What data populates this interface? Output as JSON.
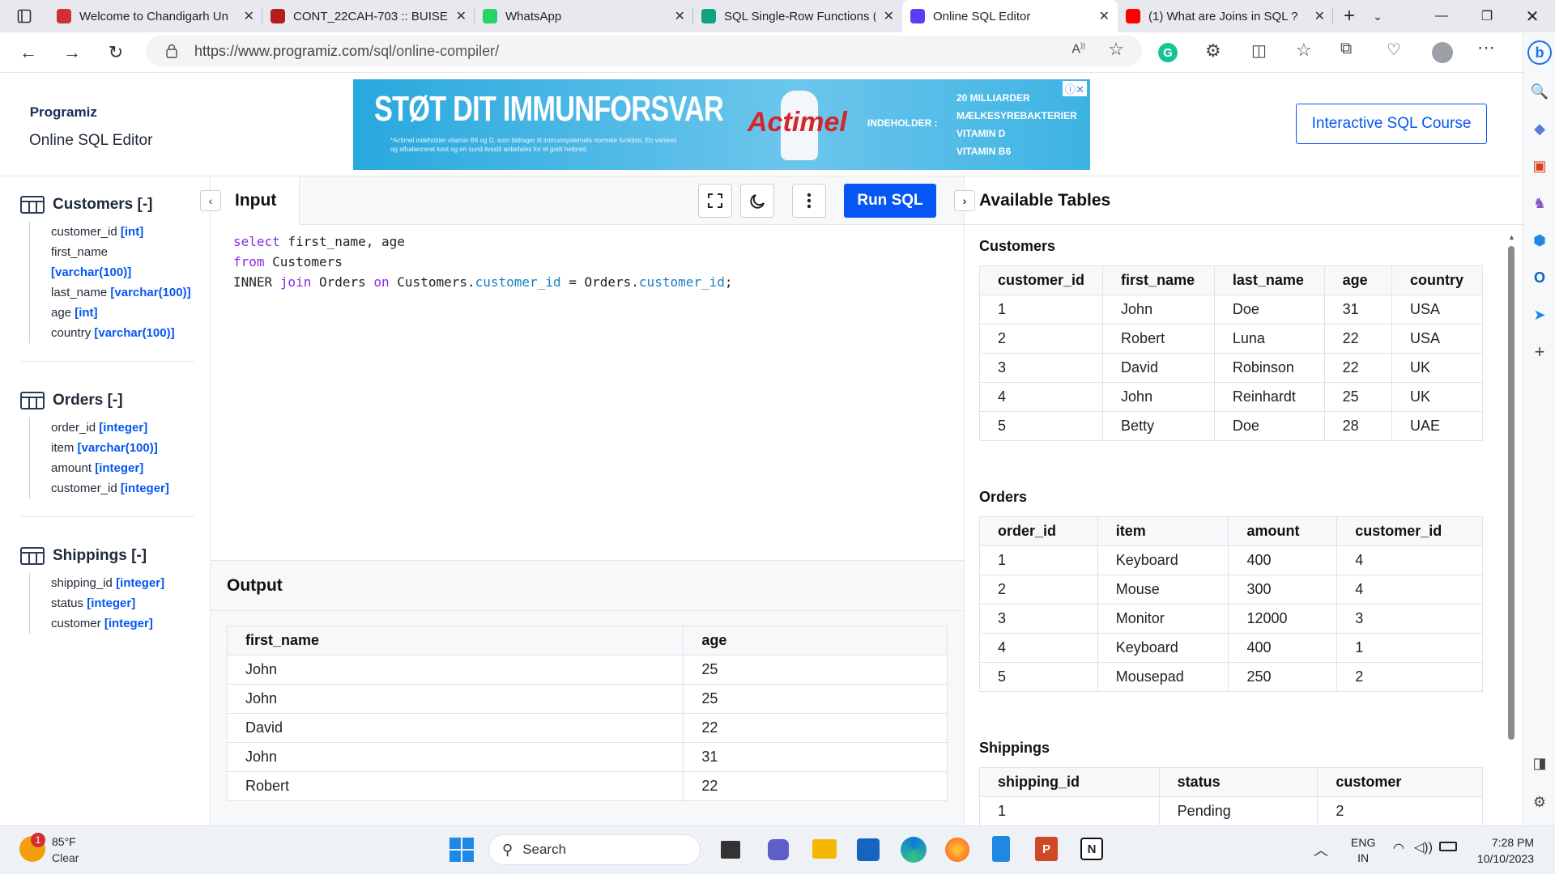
{
  "browser": {
    "tabs": [
      {
        "label": "Welcome to Chandigarh Un",
        "color": "#d32f2f"
      },
      {
        "label": "CONT_22CAH-703 :: BUISE",
        "color": "#b71c1c"
      },
      {
        "label": "WhatsApp",
        "color": "#25d366"
      },
      {
        "label": "SQL Single-Row Functions (",
        "color": "#10a37f"
      },
      {
        "label": "Online SQL Editor",
        "color": "#5b3df5"
      },
      {
        "label": "(1) What are Joins in SQL ?",
        "color": "#ff0000"
      }
    ],
    "url_host": "https://www.programiz.com",
    "url_path": "/sql/online-compiler/"
  },
  "header": {
    "logo": "Programiz",
    "subtitle": "Online SQL Editor",
    "course_button": "Interactive SQL Course"
  },
  "ad": {
    "headline": "STØT DIT IMMUNFORSVAR",
    "smallprint": "*Actimel indeholder vitamin B6 og D, som bidrager til immunsystemets normale funktion. En varieret og afbalanceret kost og en sund livsstil anbefales for et godt helbred.",
    "brand": "Actimel",
    "contains": "INDEHOLDER :",
    "facts": [
      "20 MILLIARDER MÆLKESYREBAKTERIER",
      "VITAMIN D",
      "VITAMIN B6"
    ]
  },
  "schema": [
    {
      "name": "Customers [-]",
      "columns": [
        {
          "name": "customer_id",
          "type": "[int]"
        },
        {
          "name": "first_name",
          "type": "[varchar(100)]"
        },
        {
          "name": "last_name",
          "type": "[varchar(100)]"
        },
        {
          "name": "age",
          "type": "[int]"
        },
        {
          "name": "country",
          "type": "[varchar(100)]"
        }
      ]
    },
    {
      "name": "Orders [-]",
      "columns": [
        {
          "name": "order_id",
          "type": "[integer]"
        },
        {
          "name": "item",
          "type": "[varchar(100)]"
        },
        {
          "name": "amount",
          "type": "[integer]"
        },
        {
          "name": "customer_id",
          "type": "[integer]"
        }
      ]
    },
    {
      "name": "Shippings [-]",
      "columns": [
        {
          "name": "shipping_id",
          "type": "[integer]"
        },
        {
          "name": "status",
          "type": "[integer]"
        },
        {
          "name": "customer",
          "type": "[integer]"
        }
      ]
    }
  ],
  "editor": {
    "tab": "Input",
    "run": "Run SQL",
    "code": [
      [
        [
          "kw",
          "select"
        ],
        [
          "t",
          " first_name, age"
        ]
      ],
      [
        [
          "kw",
          "from"
        ],
        [
          "t",
          " Customers"
        ]
      ],
      [
        [
          "t",
          "INNER "
        ],
        [
          "kw",
          "join"
        ],
        [
          "t",
          " Orders "
        ],
        [
          "kw",
          "on"
        ],
        [
          "t",
          " Customers."
        ],
        [
          "fld",
          "customer_id"
        ],
        [
          "t",
          " = Orders."
        ],
        [
          "fld",
          "customer_id"
        ],
        [
          "t",
          ";"
        ]
      ]
    ]
  },
  "output": {
    "title": "Output",
    "headers": [
      "first_name",
      "age"
    ],
    "rows": [
      [
        "John",
        "25"
      ],
      [
        "John",
        "25"
      ],
      [
        "David",
        "22"
      ],
      [
        "John",
        "31"
      ],
      [
        "Robert",
        "22"
      ]
    ]
  },
  "available": {
    "title": "Available Tables",
    "tables": [
      {
        "name": "Customers",
        "headers": [
          "customer_id",
          "first_name",
          "last_name",
          "age",
          "country"
        ],
        "rows": [
          [
            "1",
            "John",
            "Doe",
            "31",
            "USA"
          ],
          [
            "2",
            "Robert",
            "Luna",
            "22",
            "USA"
          ],
          [
            "3",
            "David",
            "Robinson",
            "22",
            "UK"
          ],
          [
            "4",
            "John",
            "Reinhardt",
            "25",
            "UK"
          ],
          [
            "5",
            "Betty",
            "Doe",
            "28",
            "UAE"
          ]
        ]
      },
      {
        "name": "Orders",
        "headers": [
          "order_id",
          "item",
          "amount",
          "customer_id"
        ],
        "rows": [
          [
            "1",
            "Keyboard",
            "400",
            "4"
          ],
          [
            "2",
            "Mouse",
            "300",
            "4"
          ],
          [
            "3",
            "Monitor",
            "12000",
            "3"
          ],
          [
            "4",
            "Keyboard",
            "400",
            "1"
          ],
          [
            "5",
            "Mousepad",
            "250",
            "2"
          ]
        ]
      },
      {
        "name": "Shippings",
        "headers": [
          "shipping_id",
          "status",
          "customer"
        ],
        "rows": [
          [
            "1",
            "Pending",
            "2"
          ]
        ]
      }
    ]
  },
  "taskbar": {
    "weather_temp": "85°F",
    "weather_desc": "Clear",
    "weather_badge": "1",
    "search": "Search",
    "lang1": "ENG",
    "lang2": "IN",
    "time": "7:28 PM",
    "date": "10/10/2023"
  },
  "colors": {
    "accent": "#0556f3",
    "keyword": "#8a2be2"
  }
}
